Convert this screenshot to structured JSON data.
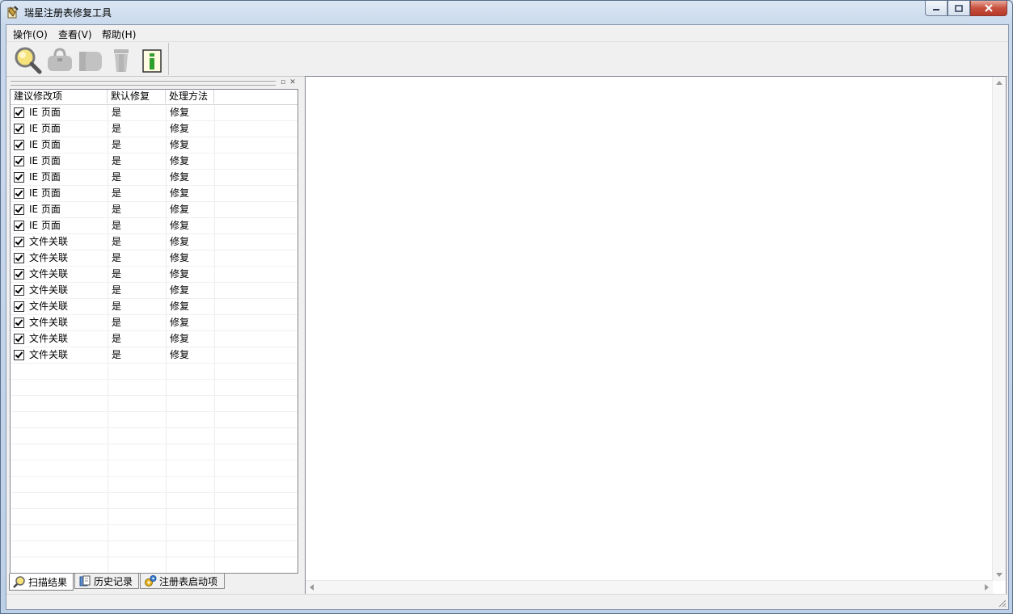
{
  "window": {
    "title": "瑞星注册表修复工具"
  },
  "menu": [
    {
      "label": "操作(O)"
    },
    {
      "label": "查看(V)"
    },
    {
      "label": "帮助(H)"
    }
  ],
  "toolbar": [
    {
      "icon": "scan-magnifier-icon"
    },
    {
      "icon": "repair-bag-icon"
    },
    {
      "icon": "backup-icon"
    },
    {
      "icon": "delete-bin-icon"
    },
    {
      "icon": "info-icon"
    }
  ],
  "list": {
    "columns": [
      "建议修改项",
      "默认修复",
      "处理方法"
    ],
    "rows": [
      {
        "checked": true,
        "item": "IE 页面",
        "default": "是",
        "method": "修复"
      },
      {
        "checked": true,
        "item": "IE 页面",
        "default": "是",
        "method": "修复"
      },
      {
        "checked": true,
        "item": "IE 页面",
        "default": "是",
        "method": "修复"
      },
      {
        "checked": true,
        "item": "IE 页面",
        "default": "是",
        "method": "修复"
      },
      {
        "checked": true,
        "item": "IE 页面",
        "default": "是",
        "method": "修复"
      },
      {
        "checked": true,
        "item": "IE 页面",
        "default": "是",
        "method": "修复"
      },
      {
        "checked": true,
        "item": "IE 页面",
        "default": "是",
        "method": "修复"
      },
      {
        "checked": true,
        "item": "IE 页面",
        "default": "是",
        "method": "修复"
      },
      {
        "checked": true,
        "item": "文件关联",
        "default": "是",
        "method": "修复"
      },
      {
        "checked": true,
        "item": "文件关联",
        "default": "是",
        "method": "修复"
      },
      {
        "checked": true,
        "item": "文件关联",
        "default": "是",
        "method": "修复"
      },
      {
        "checked": true,
        "item": "文件关联",
        "default": "是",
        "method": "修复"
      },
      {
        "checked": true,
        "item": "文件关联",
        "default": "是",
        "method": "修复"
      },
      {
        "checked": true,
        "item": "文件关联",
        "default": "是",
        "method": "修复"
      },
      {
        "checked": true,
        "item": "文件关联",
        "default": "是",
        "method": "修复"
      },
      {
        "checked": true,
        "item": "文件关联",
        "default": "是",
        "method": "修复"
      }
    ]
  },
  "tabs": [
    {
      "label": "扫描结果",
      "active": true
    },
    {
      "label": "历史记录",
      "active": false
    },
    {
      "label": "注册表启动项",
      "active": false
    }
  ]
}
